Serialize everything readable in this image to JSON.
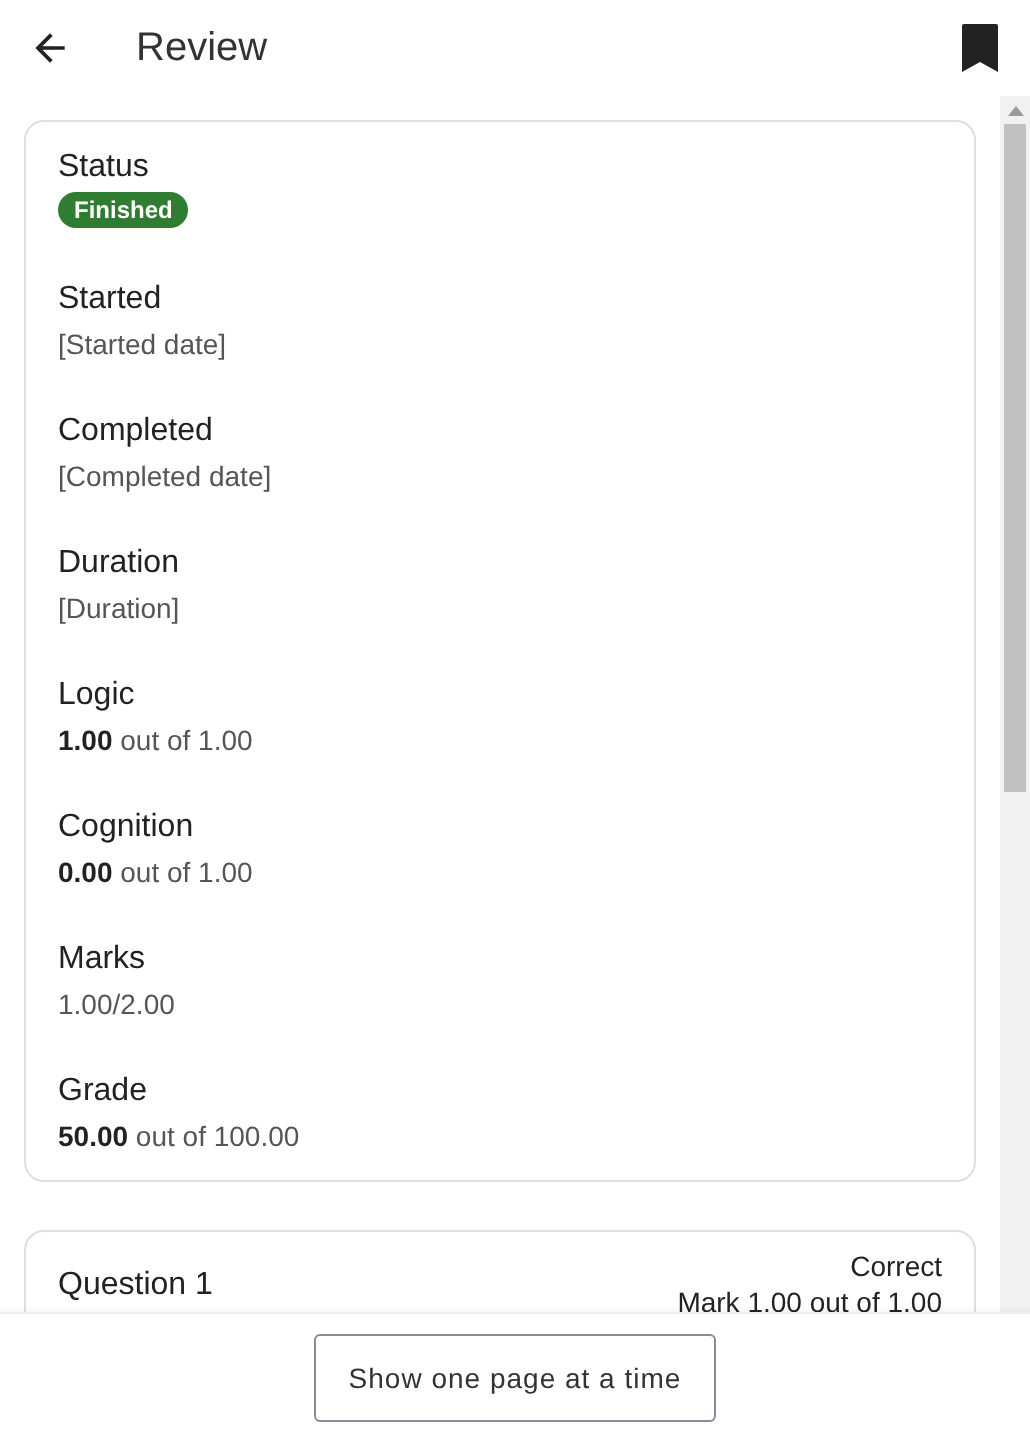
{
  "header": {
    "title": "Review"
  },
  "summary": [
    {
      "label": "Status",
      "kind": "badge",
      "value": "Finished",
      "color": "#2e7d32"
    },
    {
      "label": "Started",
      "kind": "plain",
      "value": "[Started date]"
    },
    {
      "label": "Completed",
      "kind": "plain",
      "value": "[Completed date]"
    },
    {
      "label": "Duration",
      "kind": "plain",
      "value": "[Duration]"
    },
    {
      "label": "Logic",
      "kind": "score",
      "value": "**1.00** out of 1.00"
    },
    {
      "label": "Cognition",
      "kind": "score",
      "value": "**0.00** out of 1.00"
    },
    {
      "label": "Marks",
      "kind": "plain",
      "value": "1.00/2.00"
    },
    {
      "label": "Grade",
      "kind": "score",
      "value": "**50.00** out of 100.00"
    }
  ],
  "question": {
    "title": "Question 1",
    "state": "Correct",
    "mark": "Mark 1.00 out of 1.00"
  },
  "footer": {
    "button": "Show one page at a time"
  }
}
